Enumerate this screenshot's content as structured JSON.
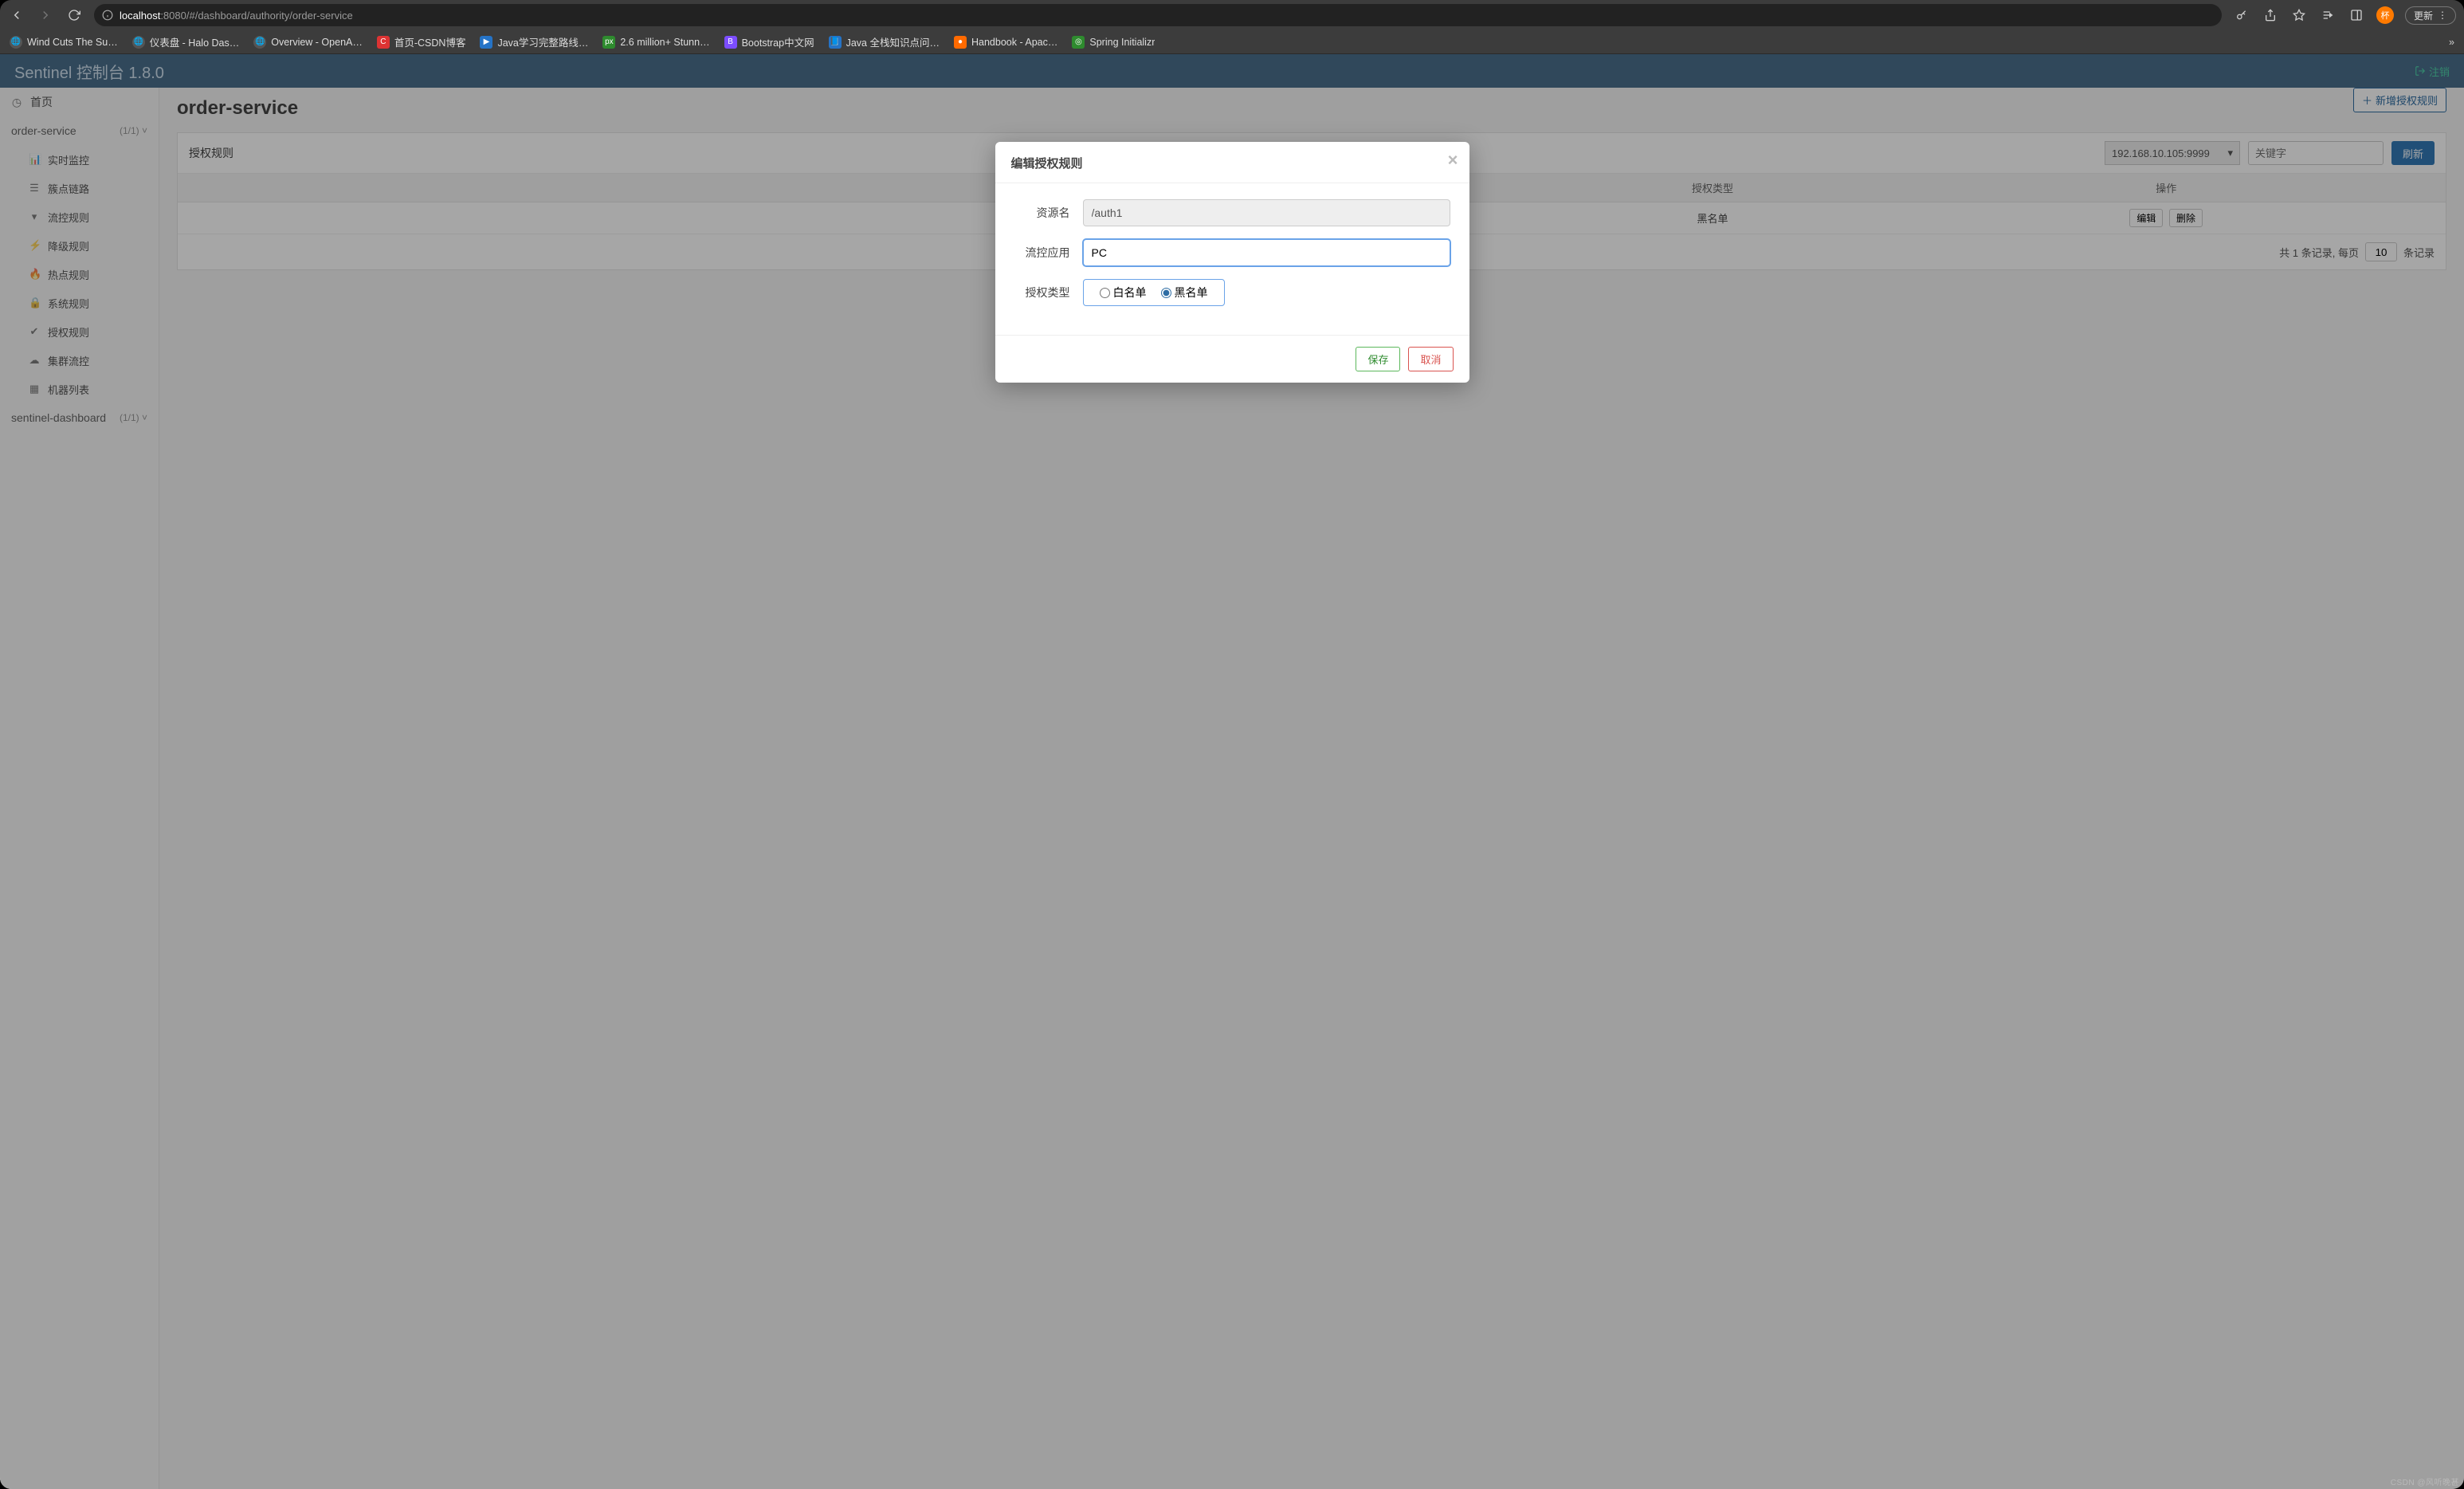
{
  "browser": {
    "url_host": "localhost",
    "url_port": ":8080",
    "url_path": "/#/dashboard/authority/order-service",
    "update_label": "更新",
    "avatar_initial": "杯",
    "bookmarks": [
      {
        "label": "Wind Cuts The Su…",
        "fav": "globe"
      },
      {
        "label": "仪表盘 - Halo Das…",
        "fav": "globe"
      },
      {
        "label": "Overview - OpenA…",
        "fav": "globe"
      },
      {
        "label": "首页-CSDN博客",
        "fav": "c-red",
        "glyph": "C"
      },
      {
        "label": "Java学习完整路线…",
        "fav": "c-blue",
        "glyph": "▶"
      },
      {
        "label": "2.6 million+ Stunn…",
        "fav": "c-green",
        "glyph": "px"
      },
      {
        "label": "Bootstrap中文网",
        "fav": "c-purple",
        "glyph": "B"
      },
      {
        "label": "Java 全栈知识点问…",
        "fav": "c-blue",
        "glyph": "📘"
      },
      {
        "label": "Handbook - Apac…",
        "fav": "c-orange",
        "glyph": "●"
      },
      {
        "label": "Spring Initializr",
        "fav": "c-green",
        "glyph": "◎"
      }
    ],
    "overflow": "»"
  },
  "app": {
    "brand": "Sentinel 控制台 1.8.0",
    "logout": "注销"
  },
  "sidebar": {
    "home": "首页",
    "groups": [
      {
        "name": "order-service",
        "count": "(1/1)",
        "expanded": true
      },
      {
        "name": "sentinel-dashboard",
        "count": "(1/1)",
        "expanded": false
      }
    ],
    "items": [
      {
        "icon": "chart-bar-icon",
        "label": "实时监控"
      },
      {
        "icon": "list-icon",
        "label": "簇点链路"
      },
      {
        "icon": "filter-icon",
        "label": "流控规则"
      },
      {
        "icon": "bolt-icon",
        "label": "降级规则"
      },
      {
        "icon": "fire-icon",
        "label": "热点规则"
      },
      {
        "icon": "lock-icon",
        "label": "系统规则"
      },
      {
        "icon": "check-icon",
        "label": "授权规则"
      },
      {
        "icon": "cloud-icon",
        "label": "集群流控"
      },
      {
        "icon": "grid-icon",
        "label": "机器列表"
      }
    ]
  },
  "page": {
    "title": "order-service",
    "add_btn": "新增授权规则",
    "panel_title": "授权规则",
    "ip_value": "192.168.10.105:9999",
    "kw_placeholder": "关键字",
    "refresh_btn": "刷新",
    "columns": {
      "col_type": "授权类型",
      "col_ops": "操作"
    },
    "row": {
      "type": "黑名单",
      "edit": "编辑",
      "delete": "删除"
    },
    "pager_prefix": "共 1 条记录, 每页",
    "pager_size": "10",
    "pager_suffix": "条记录"
  },
  "modal": {
    "title": "编辑授权规则",
    "label_resource": "资源名",
    "value_resource": "/auth1",
    "label_app": "流控应用",
    "value_app": "PC",
    "label_type": "授权类型",
    "opt_white": "白名单",
    "opt_black": "黑名单",
    "save": "保存",
    "cancel": "取消"
  },
  "watermark": "CSDN @风听晚甚"
}
